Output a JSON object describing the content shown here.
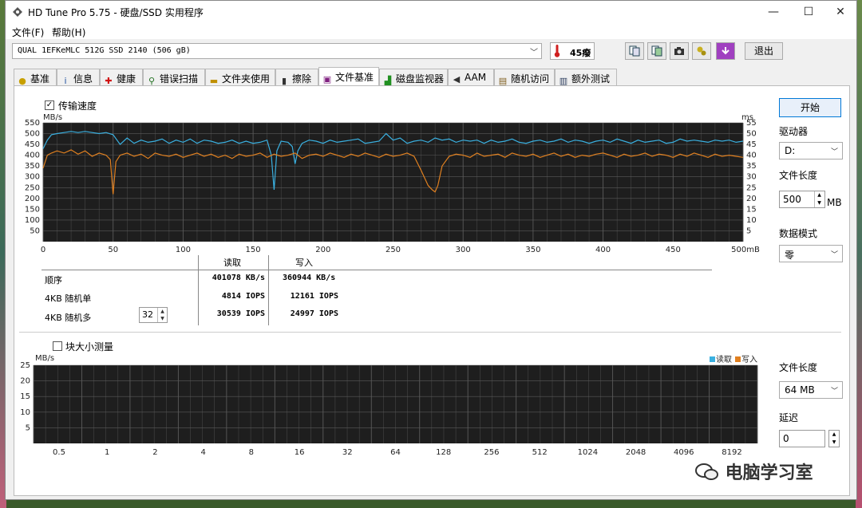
{
  "window": {
    "title": "HD Tune Pro 5.75 - 硬盘/SSD 实用程序",
    "min_glyph": "—",
    "max_glyph": "☐",
    "close_glyph": "✕"
  },
  "menu": {
    "file": "文件(F)",
    "help": "帮助(H)"
  },
  "toolbar": {
    "drive_name": "QUAL 1EFKeMLC 512G SSD 2140 (506 gB)",
    "temperature": "45癈",
    "exit_label": "退出"
  },
  "tabs": [
    {
      "label": "基准",
      "icon": "bulb-icon"
    },
    {
      "label": "信息",
      "icon": "info-icon"
    },
    {
      "label": "健康",
      "icon": "health-cross-icon"
    },
    {
      "label": "错误扫描",
      "icon": "magnifier-icon"
    },
    {
      "label": "文件夹使用",
      "icon": "folder-icon"
    },
    {
      "label": "擦除",
      "icon": "trash-icon"
    },
    {
      "label": "文件基准",
      "icon": "file-bench-icon"
    },
    {
      "label": "磁盘监视器",
      "icon": "monitor-chart-icon"
    },
    {
      "label": "AAM",
      "icon": "speaker-icon"
    },
    {
      "label": "随机访问",
      "icon": "random-access-icon"
    },
    {
      "label": "额外测试",
      "icon": "extra-test-icon"
    }
  ],
  "transfer": {
    "checkbox_label": "传输速度",
    "checked": true,
    "table": {
      "headers": [
        "读取",
        "写入"
      ],
      "rows": [
        {
          "label": "顺序",
          "read": "401078 KB/s",
          "write": "360944 KB/s"
        },
        {
          "label": "4KB 随机单",
          "read": "4814 IOPS",
          "write": "12161 IOPS"
        },
        {
          "label": "4KB 随机多",
          "read": "30539 IOPS",
          "write": "24997 IOPS"
        }
      ],
      "queue_depth": "32"
    }
  },
  "block": {
    "checkbox_label": "块大小测量",
    "checked": false
  },
  "right_panel": {
    "start_label": "开始",
    "drive_label": "驱动器",
    "drive_value": "D:",
    "file_length_label": "文件长度",
    "file_length_value": "500",
    "file_length_unit": "MB",
    "data_mode_label": "数据模式",
    "data_mode_value": "零",
    "block_file_length_label": "文件长度",
    "block_file_length_value": "64 MB",
    "delay_label": "延迟",
    "delay_value": "0"
  },
  "watermark": "电脑学习室",
  "colors": {
    "read": "#3ab0e0",
    "write": "#e08020",
    "chart_bg": "#1e1e1e",
    "grid": "#5a5a5a",
    "accent": "#0078d7"
  },
  "chart_data": [
    {
      "type": "line",
      "xlabel": "",
      "x_unit_label": "500mB",
      "ylabel_left": "MB/s",
      "ylabel_right": "ms",
      "xlim": [
        0,
        500
      ],
      "ylim": [
        0,
        550
      ],
      "y2lim": [
        0,
        55
      ],
      "x_ticks": [
        0,
        50,
        100,
        150,
        200,
        250,
        300,
        350,
        400,
        450,
        500
      ],
      "y_ticks": [
        50,
        100,
        150,
        200,
        250,
        300,
        350,
        400,
        450,
        500,
        550
      ],
      "y2_ticks": [
        5,
        10,
        15,
        20,
        25,
        30,
        35,
        40,
        45,
        50,
        55
      ],
      "grid": true,
      "series": [
        {
          "name": "读取",
          "color": "#3ab0e0",
          "x": [
            0,
            3,
            6,
            10,
            15,
            20,
            25,
            30,
            35,
            40,
            45,
            50,
            55,
            60,
            65,
            70,
            75,
            80,
            85,
            90,
            95,
            100,
            105,
            110,
            115,
            120,
            125,
            130,
            135,
            140,
            145,
            150,
            155,
            160,
            163,
            165,
            167,
            170,
            175,
            178,
            180,
            182,
            185,
            190,
            195,
            200,
            205,
            210,
            215,
            220,
            225,
            230,
            235,
            240,
            245,
            250,
            255,
            260,
            265,
            270,
            275,
            280,
            285,
            290,
            295,
            300,
            305,
            310,
            315,
            320,
            325,
            330,
            335,
            340,
            345,
            350,
            355,
            360,
            365,
            370,
            375,
            380,
            385,
            390,
            395,
            400,
            405,
            410,
            415,
            420,
            425,
            430,
            435,
            440,
            445,
            450,
            455,
            460,
            465,
            470,
            475,
            480,
            485,
            490,
            495,
            500
          ],
          "values": [
            430,
            470,
            495,
            500,
            505,
            510,
            505,
            510,
            505,
            500,
            505,
            495,
            450,
            480,
            455,
            470,
            460,
            465,
            475,
            455,
            470,
            460,
            475,
            455,
            470,
            465,
            455,
            460,
            470,
            455,
            465,
            455,
            460,
            470,
            400,
            240,
            420,
            465,
            460,
            440,
            360,
            420,
            455,
            470,
            465,
            455,
            470,
            460,
            465,
            470,
            475,
            455,
            460,
            465,
            500,
            470,
            480,
            455,
            465,
            470,
            460,
            480,
            470,
            475,
            460,
            470,
            465,
            470,
            455,
            470,
            460,
            465,
            475,
            460,
            455,
            465,
            470,
            460,
            465,
            475,
            460,
            470,
            465,
            455,
            465,
            470,
            460,
            475,
            465,
            455,
            470,
            460,
            465,
            470,
            455,
            460,
            475,
            465,
            470,
            465,
            460,
            470,
            465,
            470,
            460,
            465
          ]
        },
        {
          "name": "写入",
          "color": "#e08020",
          "x": [
            0,
            3,
            6,
            10,
            15,
            20,
            25,
            30,
            35,
            40,
            45,
            48,
            50,
            52,
            55,
            60,
            65,
            70,
            75,
            80,
            85,
            90,
            95,
            100,
            105,
            110,
            115,
            120,
            125,
            130,
            135,
            140,
            145,
            150,
            155,
            160,
            165,
            170,
            175,
            180,
            185,
            190,
            195,
            200,
            205,
            210,
            215,
            220,
            225,
            230,
            235,
            240,
            245,
            250,
            255,
            260,
            265,
            270,
            275,
            278,
            280,
            282,
            285,
            290,
            295,
            300,
            305,
            310,
            315,
            320,
            325,
            330,
            335,
            340,
            345,
            350,
            355,
            360,
            365,
            370,
            375,
            380,
            385,
            390,
            395,
            400,
            405,
            410,
            415,
            420,
            425,
            430,
            435,
            440,
            445,
            450,
            455,
            460,
            465,
            470,
            475,
            480,
            485,
            490,
            495,
            500
          ],
          "values": [
            340,
            400,
            410,
            420,
            410,
            425,
            405,
            420,
            395,
            410,
            400,
            380,
            220,
            370,
            400,
            410,
            395,
            405,
            385,
            410,
            400,
            395,
            405,
            390,
            400,
            410,
            395,
            405,
            390,
            400,
            385,
            405,
            395,
            400,
            410,
            390,
            405,
            395,
            400,
            410,
            385,
            400,
            405,
            395,
            410,
            400,
            390,
            405,
            395,
            410,
            400,
            390,
            405,
            395,
            400,
            410,
            395,
            330,
            260,
            240,
            230,
            260,
            350,
            395,
            405,
            400,
            390,
            410,
            395,
            400,
            405,
            390,
            410,
            400,
            395,
            405,
            390,
            400,
            410,
            395,
            405,
            390,
            400,
            395,
            405,
            410,
            400,
            390,
            405,
            395,
            400,
            410,
            395,
            405,
            400,
            390,
            405,
            395,
            410,
            400,
            390,
            405,
            395,
            400,
            395,
            390
          ]
        }
      ]
    },
    {
      "type": "bar",
      "ylabel": "MB/s",
      "ylim": [
        0,
        25
      ],
      "y_ticks": [
        5,
        10,
        15,
        20,
        25
      ],
      "categories": [
        "0.5",
        "1",
        "2",
        "4",
        "8",
        "16",
        "32",
        "64",
        "128",
        "256",
        "512",
        "1024",
        "2048",
        "4096",
        "8192"
      ],
      "grid": true,
      "series": [
        {
          "name": "读取",
          "color": "#3ab0e0",
          "values": []
        },
        {
          "name": "写入",
          "color": "#e08020",
          "values": []
        }
      ]
    }
  ]
}
